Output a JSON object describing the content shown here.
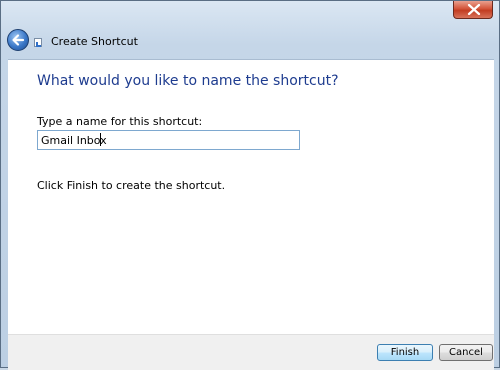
{
  "window": {
    "title": "Create Shortcut",
    "close_icon": "close-icon",
    "back_icon": "back-arrow-icon"
  },
  "content": {
    "main_instruction": "What would you like to name the shortcut?",
    "name_label": "Type a name for this shortcut:",
    "name_value": "Gmail Inbox",
    "finish_hint": "Click Finish to create the shortcut."
  },
  "footer": {
    "finish_label": "Finish",
    "cancel_label": "Cancel"
  },
  "colors": {
    "instruction_text": "#1e3c8f",
    "close_button": "#c23d22",
    "input_border": "#7ea8cf"
  }
}
